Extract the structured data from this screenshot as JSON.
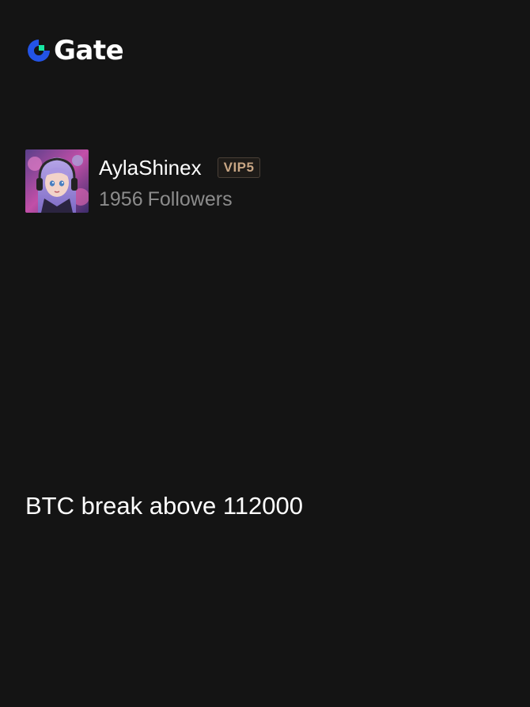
{
  "header": {
    "logo_text": "Gate",
    "logo_icon": "gate-logo-icon",
    "brand_blue": "#2354e6",
    "brand_green": "#17e6a1"
  },
  "profile": {
    "avatar_icon": "user-avatar-image",
    "username": "AylaShinex",
    "vip_badge": "VIP5",
    "followers_count": "1956",
    "followers_label": "Followers"
  },
  "post": {
    "text": "BTC break above 112000"
  },
  "colors": {
    "background": "#141414",
    "text_primary": "#ffffff",
    "text_secondary": "#8c8c8c",
    "vip_gold": "#c8a684"
  }
}
